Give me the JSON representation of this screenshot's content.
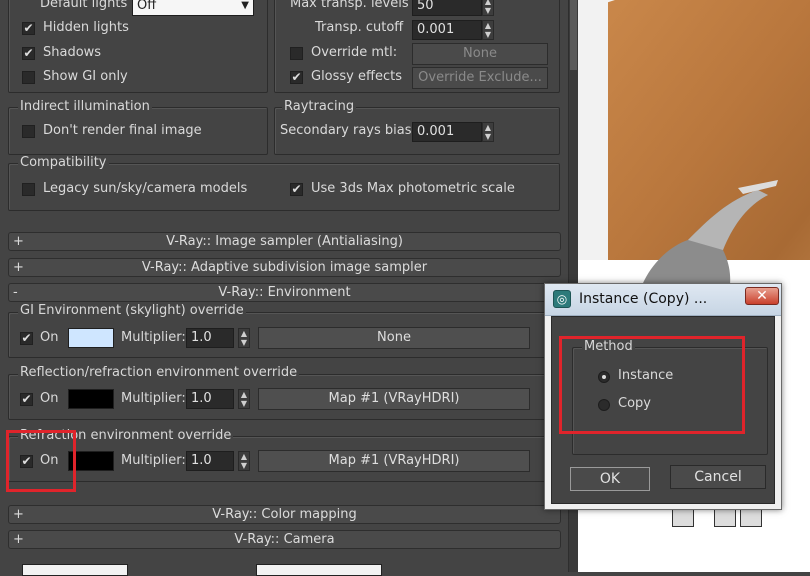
{
  "top_section": {
    "default_lights_label": "Default lights",
    "default_lights_value": "Off",
    "hidden_lights_label": "Hidden lights",
    "shadows_label": "Shadows",
    "show_gi_label": "Show GI only",
    "max_transp_label": "Max transp. levels",
    "max_transp_value": "50",
    "transp_cutoff_label": "Transp. cutoff",
    "transp_cutoff_value": "0.001",
    "override_mtl_label": "Override mtl:",
    "override_mtl_value": "None",
    "glossy_label": "Glossy effects",
    "override_exclude_label": "Override Exclude..."
  },
  "indirect": {
    "group_label": "Indirect illumination",
    "dont_render_label": "Don't render final image"
  },
  "raytracing": {
    "group_label": "Raytracing",
    "secondary_bias_label": "Secondary rays bias",
    "secondary_bias_value": "0.001"
  },
  "compatibility": {
    "group_label": "Compatibility",
    "legacy_label": "Legacy sun/sky/camera models",
    "photometric_label": "Use 3ds Max photometric scale"
  },
  "rollouts": {
    "image_sampler": "V-Ray:: Image sampler (Antialiasing)",
    "adaptive": "V-Ray:: Adaptive subdivision image sampler",
    "environment": "V-Ray:: Environment",
    "color_mapping": "V-Ray:: Color mapping",
    "camera": "V-Ray:: Camera",
    "plus": "+",
    "minus": "-"
  },
  "environment": {
    "gi_group": "GI Environment (skylight) override",
    "refl_group": "Reflection/refraction environment override",
    "refr_group": "Refraction environment override",
    "on_label": "On",
    "multiplier_label": "Multiplier:",
    "gi_multiplier": "1.0",
    "refl_multiplier": "1.0",
    "refr_multiplier": "1.0",
    "gi_map": "None",
    "refl_map": "Map #1  (VRayHDRI)",
    "refr_map": "Map #1  (VRayHDRI)",
    "gi_color": "#cfe6ff",
    "refl_color": "#000000",
    "refr_color": "#000000"
  },
  "dialog": {
    "title": "Instance (Copy) ...",
    "close": "✕",
    "method_label": "Method",
    "instance_label": "Instance",
    "copy_label": "Copy",
    "ok_label": "OK",
    "cancel_label": "Cancel"
  },
  "colors": {
    "highlight": "#e0242b",
    "panel_bg": "#444444"
  }
}
